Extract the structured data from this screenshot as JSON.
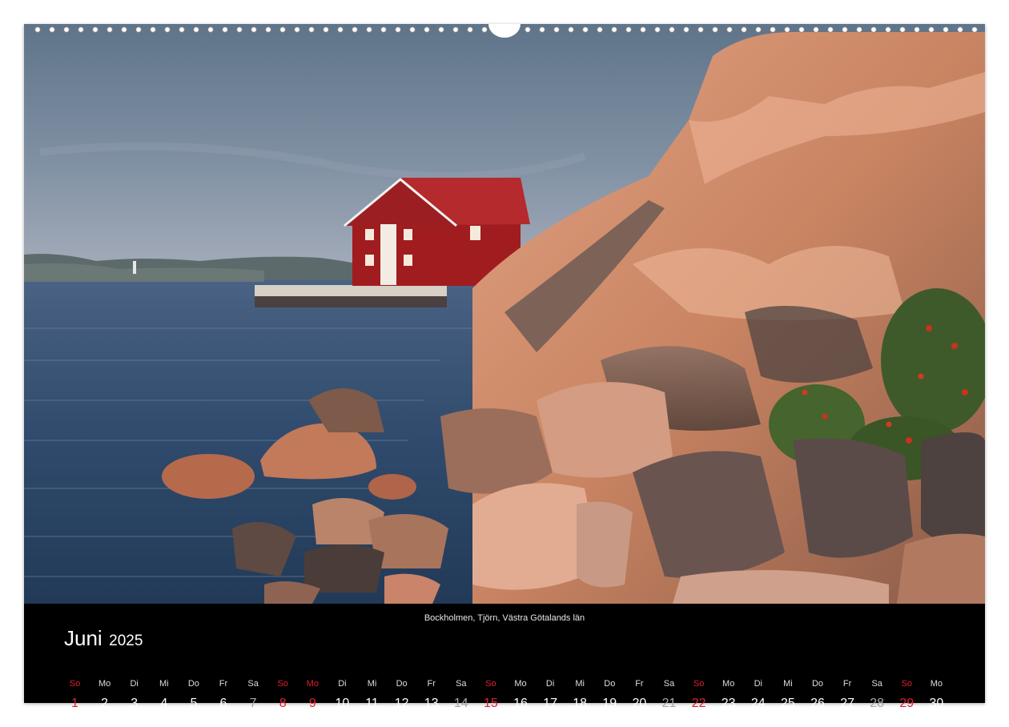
{
  "caption": "Bockholmen, Tjörn, Västra Götalands län",
  "month": {
    "name": "Juni",
    "year": "2025"
  },
  "days": [
    {
      "dn": "So",
      "dd": "1",
      "type": "sun"
    },
    {
      "dn": "Mo",
      "dd": "2",
      "type": "week"
    },
    {
      "dn": "Di",
      "dd": "3",
      "type": "week"
    },
    {
      "dn": "Mi",
      "dd": "4",
      "type": "week"
    },
    {
      "dn": "Do",
      "dd": "5",
      "type": "week"
    },
    {
      "dn": "Fr",
      "dd": "6",
      "type": "week"
    },
    {
      "dn": "Sa",
      "dd": "7",
      "type": "sat"
    },
    {
      "dn": "So",
      "dd": "8",
      "type": "sun"
    },
    {
      "dn": "Mo",
      "dd": "9",
      "type": "hol"
    },
    {
      "dn": "Di",
      "dd": "10",
      "type": "week"
    },
    {
      "dn": "Mi",
      "dd": "11",
      "type": "week"
    },
    {
      "dn": "Do",
      "dd": "12",
      "type": "week"
    },
    {
      "dn": "Fr",
      "dd": "13",
      "type": "week"
    },
    {
      "dn": "Sa",
      "dd": "14",
      "type": "sat"
    },
    {
      "dn": "So",
      "dd": "15",
      "type": "sun"
    },
    {
      "dn": "Mo",
      "dd": "16",
      "type": "week"
    },
    {
      "dn": "Di",
      "dd": "17",
      "type": "week"
    },
    {
      "dn": "Mi",
      "dd": "18",
      "type": "week"
    },
    {
      "dn": "Do",
      "dd": "19",
      "type": "week"
    },
    {
      "dn": "Fr",
      "dd": "20",
      "type": "week"
    },
    {
      "dn": "Sa",
      "dd": "21",
      "type": "sat"
    },
    {
      "dn": "So",
      "dd": "22",
      "type": "sun"
    },
    {
      "dn": "Mo",
      "dd": "23",
      "type": "week"
    },
    {
      "dn": "Di",
      "dd": "24",
      "type": "week"
    },
    {
      "dn": "Mi",
      "dd": "25",
      "type": "week"
    },
    {
      "dn": "Do",
      "dd": "26",
      "type": "week"
    },
    {
      "dn": "Fr",
      "dd": "27",
      "type": "week"
    },
    {
      "dn": "Sa",
      "dd": "28",
      "type": "sat"
    },
    {
      "dn": "So",
      "dd": "29",
      "type": "sun"
    },
    {
      "dn": "Mo",
      "dd": "30",
      "type": "week"
    }
  ],
  "colors": {
    "sunday": "#e0202e",
    "saturday": "#a7a7a7",
    "weekday": "#ffffff",
    "calendar_bg": "#000000"
  },
  "icons": {
    "binding": "spiral-binding-icon"
  }
}
